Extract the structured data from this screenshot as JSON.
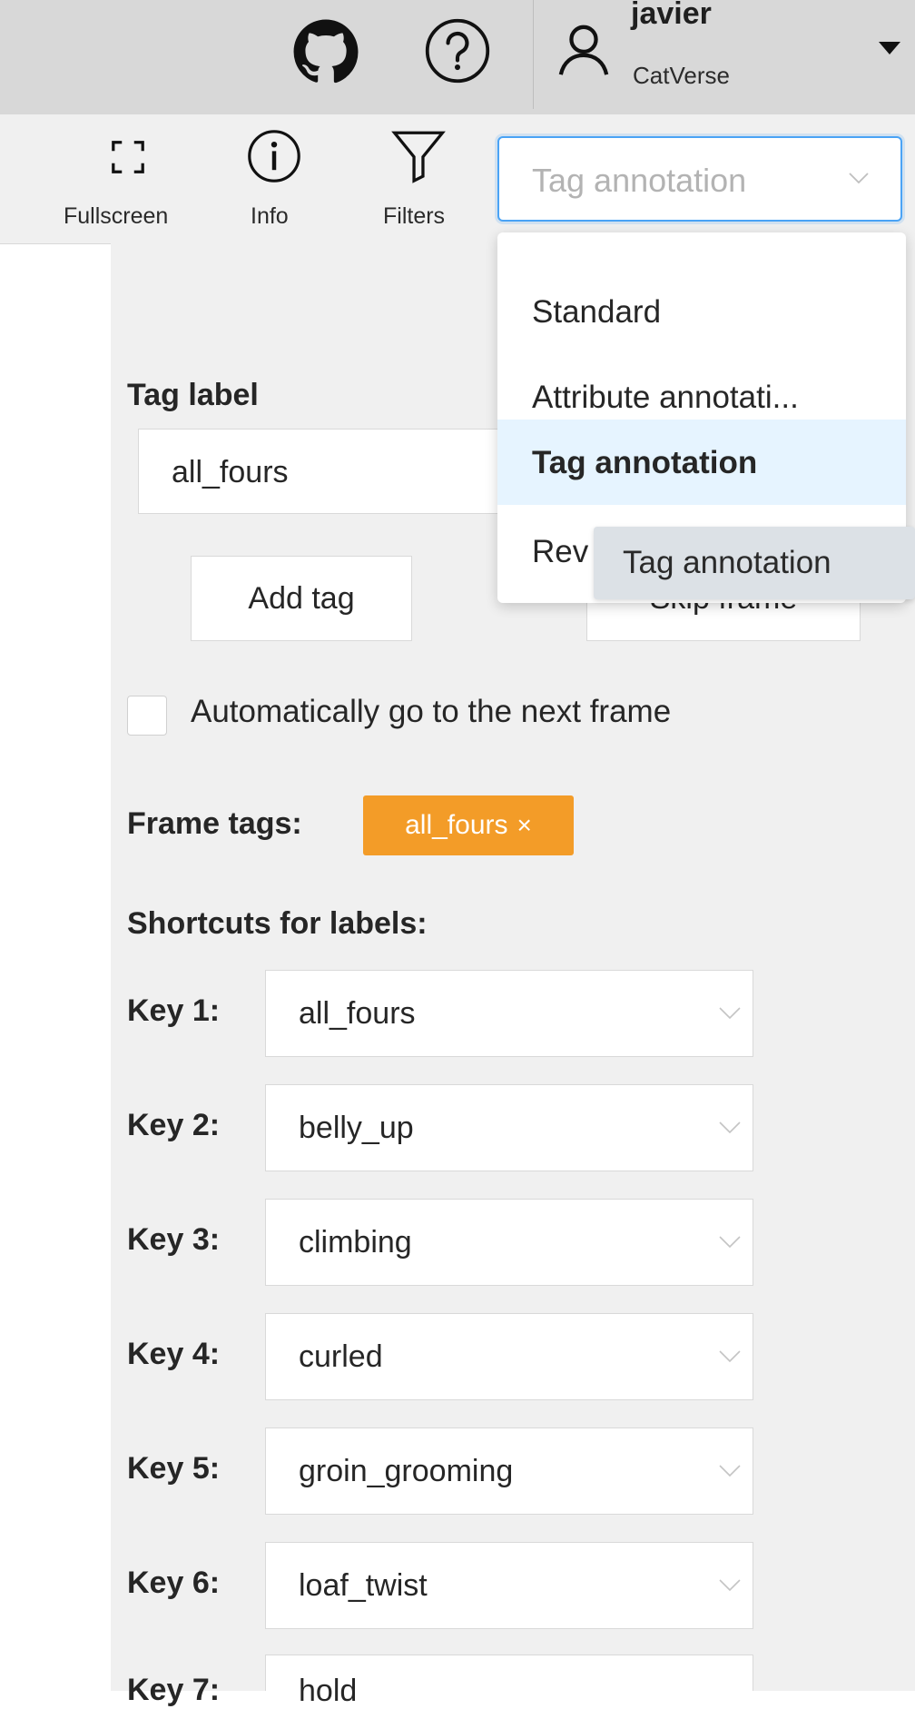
{
  "header": {
    "icons": {
      "github": "github-icon",
      "help": "help-circle-icon",
      "user": "user-icon",
      "menu": "caret-down-icon"
    },
    "user": {
      "name": "javier",
      "org": "CatVerse"
    }
  },
  "toolbar": {
    "fullscreen_label": "Fullscreen",
    "info_label": "Info",
    "filters_label": "Filters",
    "mode_select_value": "Tag annotation"
  },
  "mode_dropdown": {
    "items": [
      "Standard",
      "Attribute annotati...",
      "Tag annotation",
      "Rev"
    ],
    "selected_index": 2,
    "tooltip": "Tag annotation"
  },
  "tag_panel": {
    "tag_label_title": "Tag label",
    "tag_label_value": "all_fours",
    "add_tag_label": "Add tag",
    "skip_frame_label": "Skip frame",
    "auto_next_label": "Automatically go to the next frame",
    "auto_next_checked": false,
    "frame_tags_title": "Frame tags:",
    "frame_tags": [
      "all_fours"
    ],
    "shortcuts_title": "Shortcuts for labels:",
    "shortcuts": [
      {
        "key": "Key 1:",
        "value": "all_fours"
      },
      {
        "key": "Key 2:",
        "value": "belly_up"
      },
      {
        "key": "Key 3:",
        "value": "climbing"
      },
      {
        "key": "Key 4:",
        "value": "curled"
      },
      {
        "key": "Key 5:",
        "value": "groin_grooming"
      },
      {
        "key": "Key 6:",
        "value": "loaf_twist"
      },
      {
        "key": "Key 7:",
        "value": "hold"
      }
    ]
  },
  "colors": {
    "accent": "#4aa3f5",
    "tag_chip": "#f39c28",
    "active_item": "#e6f4ff"
  }
}
